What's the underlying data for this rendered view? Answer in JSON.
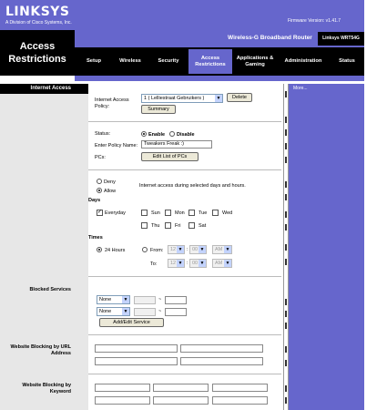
{
  "brand": {
    "name": "LINKSYS",
    "tagline": "A Division of Cisco Systems, Inc.",
    "firmware": "Firmware Version: v1.41.7"
  },
  "header": {
    "section_title": "Access Restrictions",
    "router_name": "Wireless-G Broadband Router",
    "model": "Linksys WRT54G"
  },
  "tabs": [
    {
      "label": "Setup"
    },
    {
      "label": "Wireless"
    },
    {
      "label": "Security"
    },
    {
      "label": "Access Restrictions"
    },
    {
      "label": "Applications & Gaming"
    },
    {
      "label": "Administration"
    },
    {
      "label": "Status"
    }
  ],
  "sidebar": {
    "internet_access": "Internet Access",
    "blocked_services": "Blocked Services",
    "website_url": "Website Blocking by URL Address",
    "website_keyword": "Website Blocking by Keyword"
  },
  "right_panel": {
    "more": "More..."
  },
  "policy": {
    "label": "Internet Access Policy:",
    "selected": "1 ( Lelliestraat Gebruikers )",
    "delete": "Delete",
    "summary": "Summary"
  },
  "status": {
    "label": "Status:",
    "enable": "Enable",
    "disable": "Disable",
    "policy_name_label": "Enter Policy Name:",
    "policy_name": "Tweakers Freak :)",
    "pcs_label": "PCs:",
    "edit_pcs": "Edit List of PCs"
  },
  "access": {
    "deny": "Deny",
    "allow": "Allow",
    "description": "Internet access during selected days and hours."
  },
  "days": {
    "title": "Days",
    "everyday": "Everyday",
    "sun": "Sun",
    "mon": "Mon",
    "tue": "Tue",
    "wed": "Wed",
    "thu": "Thu",
    "fri": "Fri",
    "sat": "Sat"
  },
  "times": {
    "title": "Times",
    "hours24": "24 Hours",
    "from": "From:",
    "to": "To:",
    "from_h": "12",
    "from_m": "00",
    "from_ampm": "AM",
    "to_h": "12",
    "to_m": "00",
    "to_ampm": "AM"
  },
  "services": {
    "none1": "None",
    "none2": "None",
    "dash": "~",
    "add_edit": "Add/Edit Service"
  }
}
